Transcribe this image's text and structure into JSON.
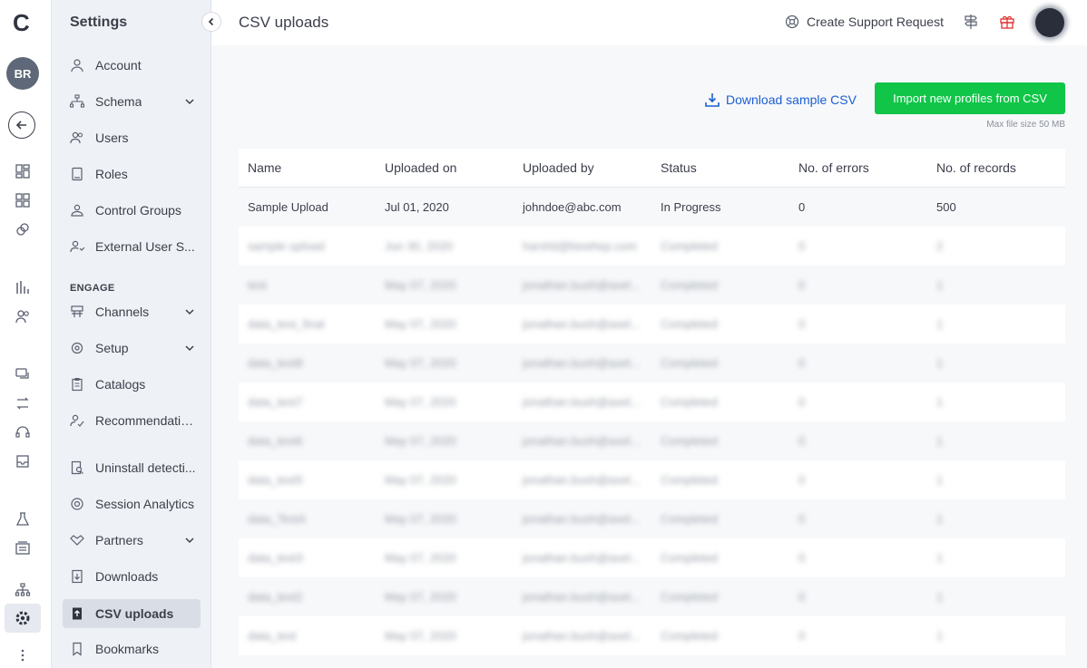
{
  "rail": {
    "logo": "C",
    "avatar_initials": "BR"
  },
  "sidebar": {
    "title": "Settings",
    "section_engage": "ENGAGE",
    "items": [
      {
        "label": "Account"
      },
      {
        "label": "Schema"
      },
      {
        "label": "Users"
      },
      {
        "label": "Roles"
      },
      {
        "label": "Control Groups"
      },
      {
        "label": "External User S..."
      },
      {
        "label": "Channels"
      },
      {
        "label": "Setup"
      },
      {
        "label": "Catalogs"
      },
      {
        "label": "Recommendatio..."
      },
      {
        "label": "Uninstall detecti..."
      },
      {
        "label": "Session Analytics"
      },
      {
        "label": "Partners"
      },
      {
        "label": "Downloads"
      },
      {
        "label": "CSV uploads"
      },
      {
        "label": "Bookmarks"
      }
    ]
  },
  "header": {
    "title": "CSV uploads",
    "support_label": "Create Support Request"
  },
  "actions": {
    "download_label": "Download sample CSV",
    "import_label": "Import new profiles from CSV",
    "file_size_note": "Max file size 50 MB"
  },
  "table": {
    "columns": [
      "Name",
      "Uploaded on",
      "Uploaded by",
      "Status",
      "No. of errors",
      "No. of records"
    ],
    "rows": [
      [
        "Sample Upload",
        "Jul 01, 2020",
        "johndoe@abc.com",
        "In Progress",
        "0",
        "500"
      ],
      [
        "sample upload",
        "Jun 30, 2020",
        "harshit@bewhep.com",
        "Completed",
        "0",
        "2"
      ],
      [
        "test",
        "May 07, 2020",
        "jonathan.bush@axel...",
        "Completed",
        "0",
        "1"
      ],
      [
        "data_test_final",
        "May 07, 2020",
        "jonathan.bush@axel...",
        "Completed",
        "0",
        "1"
      ],
      [
        "data_test8",
        "May 07, 2020",
        "jonathan.bush@axel...",
        "Completed",
        "0",
        "1"
      ],
      [
        "data_test7",
        "May 07, 2020",
        "jonathan.bush@axel...",
        "Completed",
        "0",
        "1"
      ],
      [
        "data_test6",
        "May 07, 2020",
        "jonathan.bush@axel...",
        "Completed",
        "0",
        "1"
      ],
      [
        "data_test5",
        "May 07, 2020",
        "jonathan.bush@axel...",
        "Completed",
        "0",
        "1"
      ],
      [
        "data_Test4",
        "May 07, 2020",
        "jonathan.bush@axel...",
        "Completed",
        "0",
        "1"
      ],
      [
        "data_test3",
        "May 07, 2020",
        "jonathan.bush@axel...",
        "Completed",
        "0",
        "1"
      ],
      [
        "data_test2",
        "May 07, 2020",
        "jonathan.bush@axel...",
        "Completed",
        "0",
        "1"
      ],
      [
        "data_test",
        "May 07, 2020",
        "jonathan.bush@axel...",
        "Completed",
        "0",
        "1"
      ]
    ]
  },
  "colors": {
    "accent_green": "#10c548",
    "link_blue": "#1a5fd0",
    "gift_red": "#e0312f"
  }
}
